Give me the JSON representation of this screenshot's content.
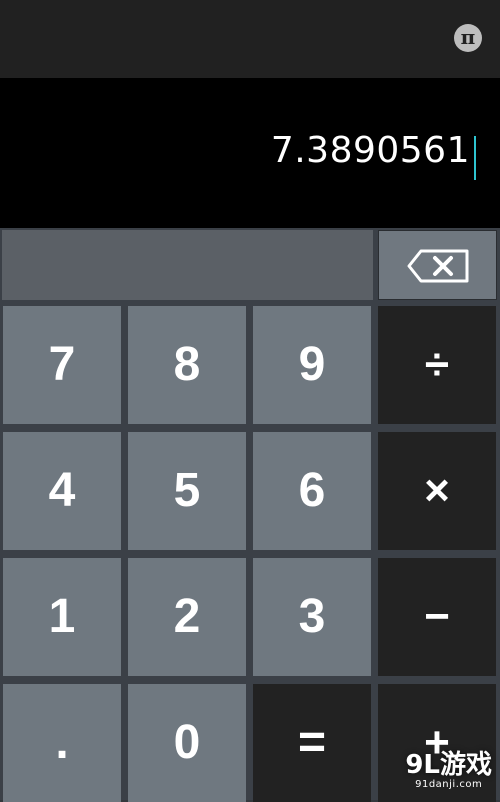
{
  "topbar": {
    "pi_label": "π"
  },
  "display": {
    "value": "7.3890561"
  },
  "keys": {
    "k7": "7",
    "k8": "8",
    "k9": "9",
    "div": "÷",
    "k4": "4",
    "k5": "5",
    "k6": "6",
    "mul": "×",
    "k1": "1",
    "k2": "2",
    "k3": "3",
    "minus": "−",
    "dot": ".",
    "k0": "0",
    "eq": "=",
    "plus": "+"
  },
  "watermark": {
    "brand": "9L游戏",
    "site": "91danji.com"
  },
  "colors": {
    "display_bg": "#000000",
    "digit_key": "#6f7880",
    "operator_key": "#222222",
    "cursor": "#2ec4d0"
  }
}
